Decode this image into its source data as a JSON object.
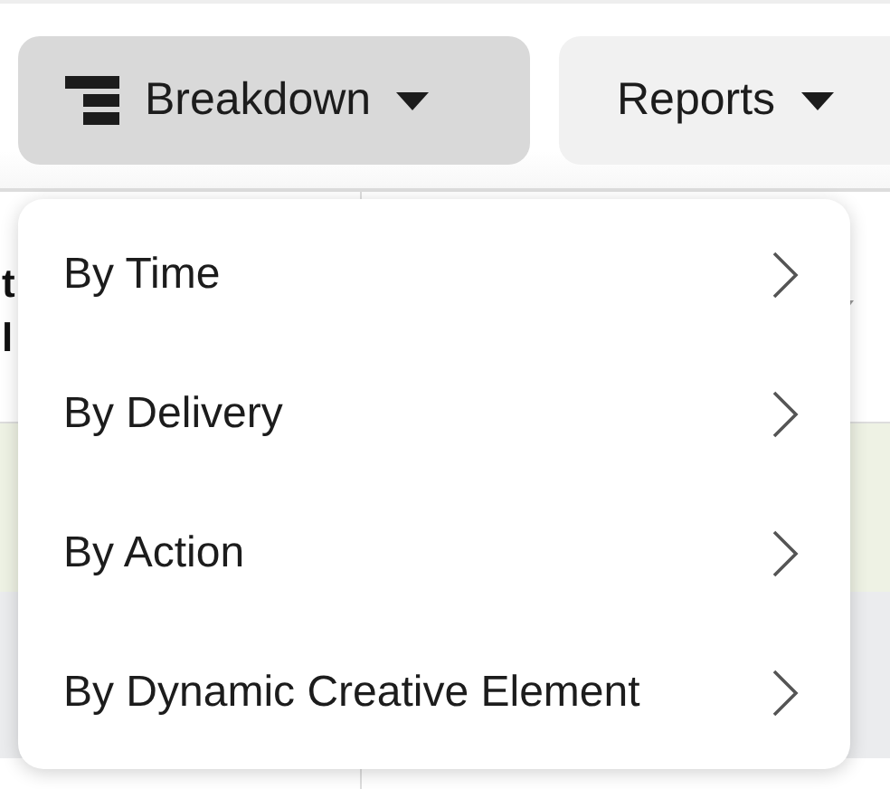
{
  "toolbar": {
    "buttons": [
      {
        "label": "Breakdown",
        "kind": "breakdown",
        "selected": true
      },
      {
        "label": "Reports",
        "kind": "plain",
        "selected": false
      }
    ]
  },
  "table": {
    "header_fragments": [
      "t",
      "l"
    ]
  },
  "menu": {
    "items": [
      {
        "label": "By Time",
        "has_submenu": true
      },
      {
        "label": "By Delivery",
        "has_submenu": true
      },
      {
        "label": "By Action",
        "has_submenu": true
      },
      {
        "label": "By Dynamic Creative Element",
        "has_submenu": true
      }
    ]
  }
}
